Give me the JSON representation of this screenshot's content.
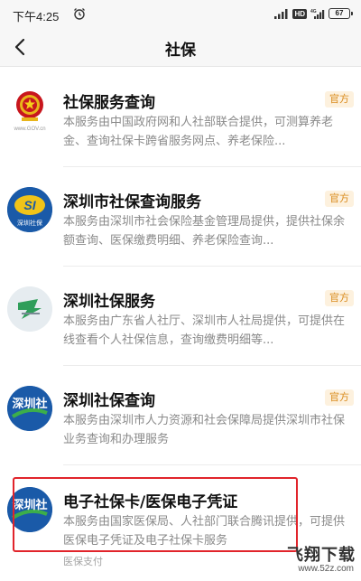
{
  "status_bar": {
    "time": "下午4:25",
    "battery": "67",
    "network_badge": "HD",
    "network_type": "4G"
  },
  "header": {
    "title": "社保"
  },
  "items": [
    {
      "logo": "gov-emblem-icon",
      "title": "社保服务查询",
      "tag": "官方",
      "description": "本服务由中国政府网和人社部联合提供，可测算养老金、查询社保卡跨省服务网点、养老保险..."
    },
    {
      "logo": "shenzhen-social-security-logo",
      "logo_text": "深圳社保",
      "title": "深圳市社保查询服务",
      "tag": "官方",
      "description": "本服务由深圳市社会保险基金管理局提供，提供社保余额查询、医保缴费明细、养老保险查询..."
    },
    {
      "logo": "guangdong-hr-logo",
      "title": "深圳社保服务",
      "tag": "官方",
      "description": "本服务由广东省人社厅、深圳市人社局提供，可提供在线查看个人社保信息，查询缴费明细等..."
    },
    {
      "logo": "shenzhen-hr-logo",
      "logo_text": "深圳社",
      "title": "深圳社保查询",
      "tag": "官方",
      "description": "本服务由深圳市人力资源和社会保障局提供深圳市社保业务查询和办理服务"
    },
    {
      "logo": "shenzhen-hr-logo",
      "logo_text": "深圳社",
      "title": "电子社保卡/医保电子凭证",
      "description": "本服务由国家医保局、人社部门联合腾讯提供，可提供医保电子凭证及电子社保卡服务",
      "source": "医保支付"
    }
  ],
  "watermark": {
    "main": "飞翔下载",
    "sub": "www.52z.com"
  },
  "colors": {
    "accent_tag_text": "#d98a1b",
    "accent_tag_bg": "#fdf1de",
    "highlight": "#e1242b",
    "shenzhen_blue": "#1a5aa8",
    "gov_red": "#c8161d"
  }
}
